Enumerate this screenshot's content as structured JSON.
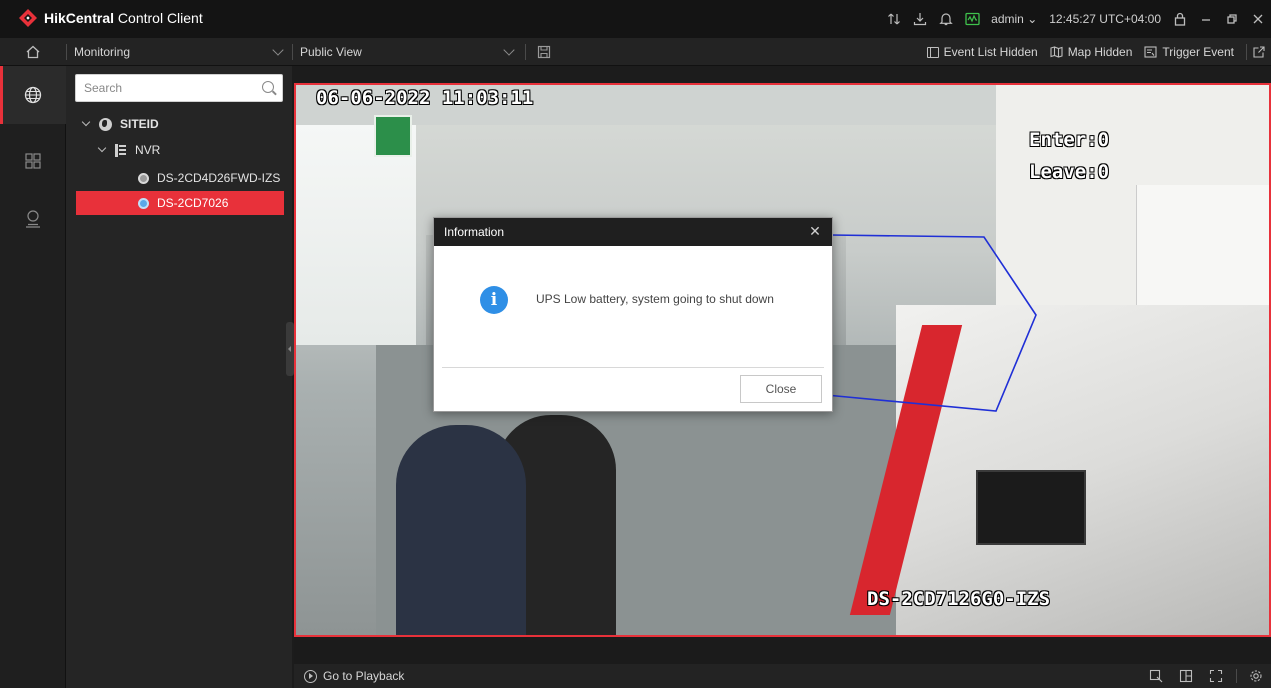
{
  "window": {
    "brand_bold": "HikCentral",
    "brand_rest": " Control Client",
    "user": "admin",
    "clock": "12:45:27 UTC+04:00"
  },
  "toolbar": {
    "module": "Monitoring",
    "view": "Public View",
    "event_list": "Event List Hidden",
    "map": "Map Hidden",
    "trigger": "Trigger Event"
  },
  "tree": {
    "search_placeholder": "Search",
    "site": "SITEID",
    "device": "NVR",
    "cameras": [
      {
        "label": "DS-2CD4D26FWD-IZS",
        "online": false,
        "selected": false
      },
      {
        "label": "DS-2CD7026",
        "online": true,
        "selected": true
      }
    ]
  },
  "video": {
    "timestamp": "06-06-2022 11:03:11",
    "enter": "Enter:0",
    "leave": "Leave:0",
    "camera_name": "DS-2CD7126G0-IZS",
    "roi_color": "#1f2fd6"
  },
  "dialog": {
    "title": "Information",
    "message": "UPS Low battery, system going to shut down",
    "close_label": "Close"
  },
  "bottom": {
    "playback": "Go to Playback"
  },
  "colors": {
    "accent": "#e8313a",
    "info": "#2f8fe6"
  }
}
